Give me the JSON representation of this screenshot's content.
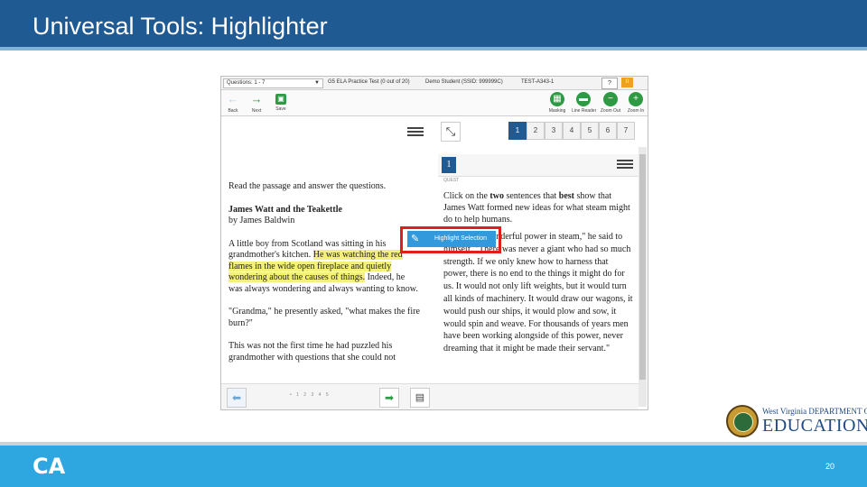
{
  "slide": {
    "title": "Universal Tools: Highlighter",
    "page_number": "20",
    "logo": {
      "line1": "West Virginia DEPARTMENT OF",
      "line2": "EDUCATION",
      "mark": "CA"
    }
  },
  "app": {
    "question_select": "Questions: 1 - 7",
    "test_name": "G5 ELA Practice Test (0 out of 20)",
    "student": "Demo Student (SSID: 999999C)",
    "test_id": "TEST-A343-1",
    "help_label": "?",
    "pause_label": "II",
    "toolbar": {
      "back": "Back",
      "next": "Next",
      "save": "Save",
      "masking": "Masking",
      "line_reader": "Line Reader",
      "zoom_out": "Zoom Out",
      "zoom_in": "Zoom In"
    },
    "question_tabs": [
      "1",
      "2",
      "3",
      "4",
      "5",
      "6",
      "7"
    ],
    "active_tab": "1",
    "passage": {
      "instruction": "Read the passage and answer the questions.",
      "title": "James Watt and the Teakettle",
      "author": "by James Baldwin",
      "p1_before": "A little boy from Scotland was sitting in his grandmother's kitchen. ",
      "p1_highlight": "He was watching the red flames in the wide open fireplace and quietly wondering about the causes of things.",
      "p1_after": " Indeed, he was always wondering and always wanting to know.",
      "p2": "\"Grandma,\" he presently asked, \"what makes the fire burn?\"",
      "p3": "This was not the first time he had puzzled his grandmother with questions that she could not"
    },
    "question": {
      "number": "1",
      "label": "QUEST",
      "prompt_a": "Click on the ",
      "prompt_b": "two",
      "prompt_c": " sentences that ",
      "prompt_d": "best",
      "prompt_e": " show that James Watt formed new ideas for what steam might do to help humans.",
      "quote": "\"There is a wonderful power in steam,\" he said to himself. \"There was never a giant who had so much strength. If we only knew how to harness that power, there is no end to the things it might do for us. It would not only lift weights, but it would turn all kinds of machinery. It would draw our wagons, it would push our ships, it would plow and sow, it would spin and weave. For thousands of years men have been working alongside of this power, never dreaming that it might be made their servant.\""
    },
    "highlight_button": "Highlight Selection",
    "bottom_dots": "• 1 2 3 4 5"
  },
  "colors": {
    "title_bar": "#1f5a93",
    "footer": "#2ea7e0",
    "highlight": "#f5f07a",
    "callout_border": "#e11d1d"
  }
}
